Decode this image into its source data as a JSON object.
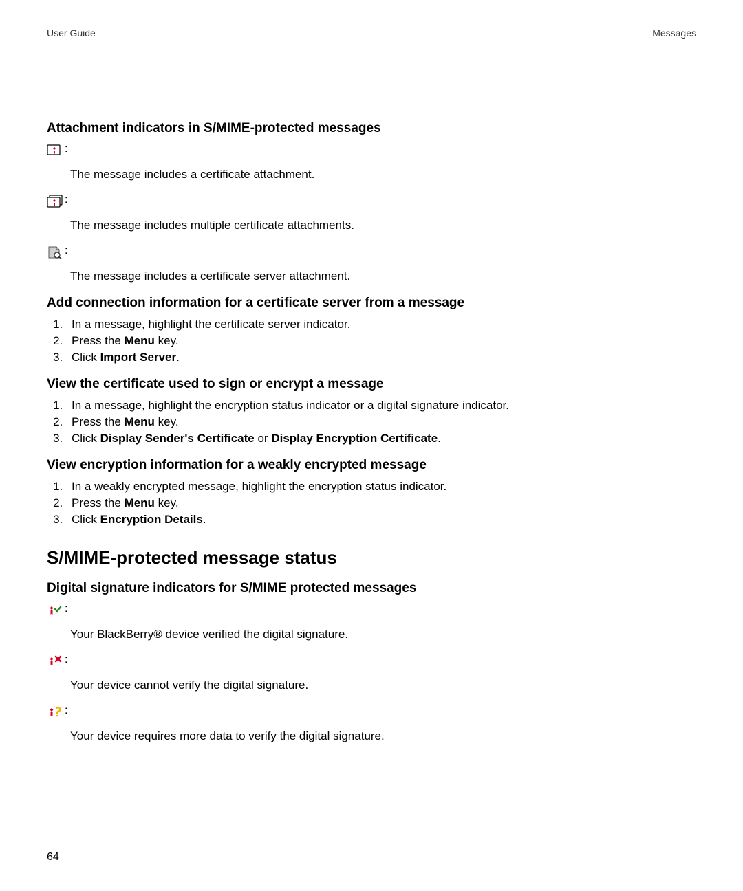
{
  "header": {
    "left": "User Guide",
    "right": "Messages"
  },
  "section1": {
    "title": "Attachment indicators in S/MIME-protected messages",
    "indA": {
      "desc": "The message includes a certificate attachment."
    },
    "indB": {
      "desc": "The message includes multiple certificate attachments."
    },
    "indC": {
      "desc": "The message includes a certificate server attachment."
    }
  },
  "section2": {
    "title": "Add connection information for a certificate server from a message",
    "step1": "In a message, highlight the certificate server indicator.",
    "step2_a": "Press the ",
    "step2_b": "Menu",
    "step2_c": " key.",
    "step3_a": "Click ",
    "step3_b": "Import Server",
    "step3_c": "."
  },
  "section3": {
    "title": "View the certificate used to sign or encrypt a message",
    "step1": "In a message, highlight the encryption status indicator or a digital signature indicator.",
    "step2_a": "Press the ",
    "step2_b": "Menu",
    "step2_c": " key.",
    "step3_a": "Click ",
    "step3_b": "Display Sender's Certificate",
    "step3_c": " or ",
    "step3_d": "Display Encryption Certificate",
    "step3_e": "."
  },
  "section4": {
    "title": "View encryption information for a weakly encrypted message",
    "step1": "In a weakly encrypted message, highlight the encryption status indicator.",
    "step2_a": "Press the ",
    "step2_b": "Menu",
    "step2_c": " key.",
    "step3_a": "Click ",
    "step3_b": "Encryption Details",
    "step3_c": "."
  },
  "majorHeading": "S/MIME-protected message status",
  "section5": {
    "title": "Digital signature indicators for S/MIME protected messages",
    "indA": {
      "desc": "Your BlackBerry® device verified the digital signature."
    },
    "indB": {
      "desc": "Your device cannot verify the digital signature."
    },
    "indC": {
      "desc": "Your device requires more data to verify the digital signature."
    }
  },
  "pageNumber": "64"
}
